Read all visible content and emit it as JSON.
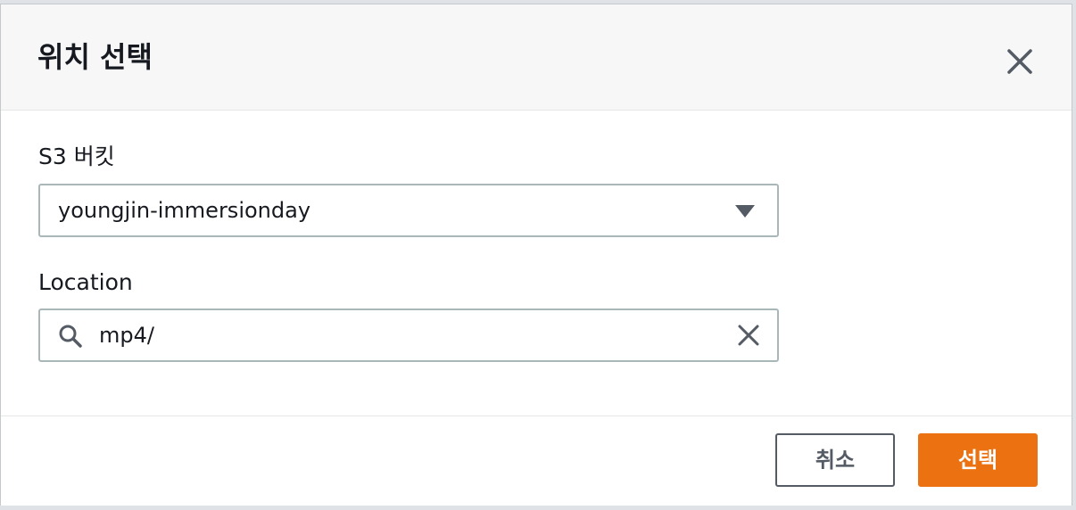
{
  "dialog": {
    "title": "위치 선택",
    "close_icon": "close-icon"
  },
  "bucket": {
    "label": "S3 버킷",
    "selected": "youngjin-immersionday",
    "caret_icon": "caret-down-icon"
  },
  "location": {
    "label": "Location",
    "value": "mp4/",
    "search_icon": "search-icon",
    "clear_icon": "clear-icon"
  },
  "footer": {
    "cancel_label": "취소",
    "select_label": "선택"
  },
  "colors": {
    "primary": "#ec7211",
    "text": "#16191f",
    "border": "#aab7b8",
    "header_bg": "#f7f7f7"
  }
}
